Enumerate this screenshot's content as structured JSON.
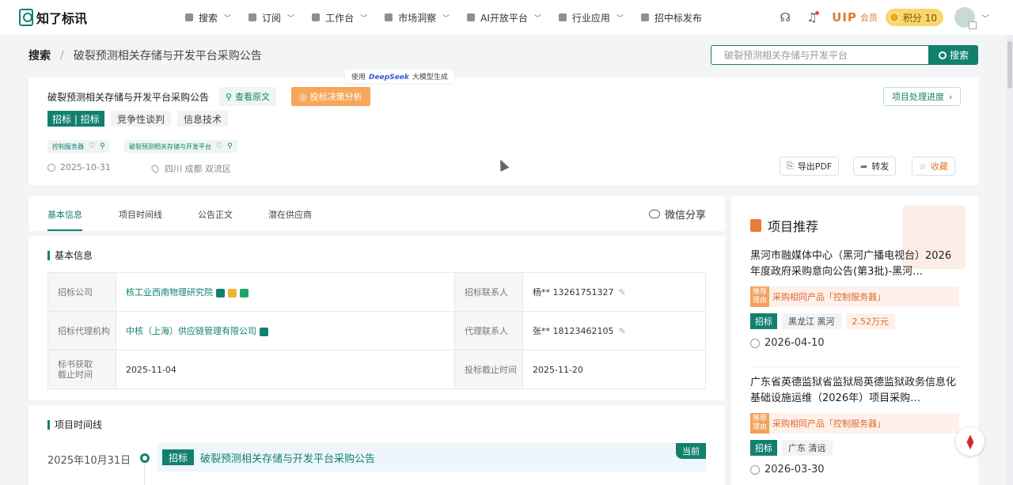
{
  "nav": {
    "logo_text": "知了标讯",
    "items": [
      {
        "label": "搜索",
        "caret": true
      },
      {
        "label": "订阅",
        "caret": true
      },
      {
        "label": "工作台",
        "caret": true
      },
      {
        "label": "市场洞察",
        "caret": true
      },
      {
        "label": "AI开放平台",
        "caret": true
      },
      {
        "label": "行业应用",
        "caret": true
      },
      {
        "label": "招中标发布",
        "caret": false
      }
    ],
    "vip": "UIP",
    "vip_sub": "会员",
    "points": "积分 10"
  },
  "breadcrumb": {
    "root": "搜索",
    "sep": "/",
    "current": "破裂预测相关存储与开发平台采购公告"
  },
  "search": {
    "value": "破裂预测相关存储与开发平台",
    "button": "搜索"
  },
  "header": {
    "deepseek_prefix": "使用",
    "deepseek_name": "DeepSeek",
    "deepseek_suffix": "大模型生成",
    "title": "破裂预测相关存储与开发平台采购公告",
    "view_source": "查看原文",
    "analysis": "投标决策分析",
    "progress": "项目处理进度",
    "tag_main": "招标 | 招标",
    "tag_method": "竞争性谈判",
    "tag_industry": "信息技术",
    "keywords": [
      "控制服务器",
      "破裂预测相关存储与开发平台"
    ],
    "date": "2025-10-31",
    "location": "四川 成都 双流区",
    "export_pdf": "导出PDF",
    "forward": "转发",
    "favorite": "收藏"
  },
  "tabs": {
    "items": [
      "基本信息",
      "项目时间线",
      "公告正文",
      "潜在供应商"
    ],
    "share": "微信分享"
  },
  "basic_info": {
    "title": "基本信息",
    "rows": [
      {
        "l1": "招标公司",
        "v1": "核工业西南物理研究院",
        "l2": "招标联系人",
        "v2": "杨** 13261751327"
      },
      {
        "l1": "招标代理机构",
        "v1": "中核（上海）供应链管理有限公司",
        "l2": "代理联系人",
        "v2": "张** 18123462105"
      },
      {
        "l1": "标书获取\n截止时间",
        "v1": "2025-11-04",
        "l2": "投标截止时间",
        "v2": "2025-11-20"
      }
    ]
  },
  "timeline": {
    "title": "项目时间线",
    "date": "2025年10月31日",
    "tag": "招标",
    "item_title": "破裂预测相关存储与开发平台采购公告",
    "current": "当前"
  },
  "recommend": {
    "title": "项目推荐",
    "items": [
      {
        "title": "黑河市融媒体中心（黑河广播电视台）2026年度政府采购意向公告(第3批)-黑河…",
        "reason_tag": "推荐理由",
        "reason": "采购相同产品「控制服务器」",
        "type": "招标",
        "region": "黑龙江 黑河",
        "amount": "2.52万元",
        "date": "2026-04-10"
      },
      {
        "title": "广东省英德监狱省监狱局英德监狱政务信息化基础设施运维（2026年）项目采购…",
        "reason_tag": "推荐理由",
        "reason": "采购相同产品「控制服务器」",
        "type": "招标",
        "region": "广东 清远",
        "amount": "",
        "date": "2026-03-30"
      }
    ]
  },
  "colors": {
    "brand": "#12806f",
    "accent_orange": "#f6a75a",
    "bg": "#f3f4f6"
  }
}
